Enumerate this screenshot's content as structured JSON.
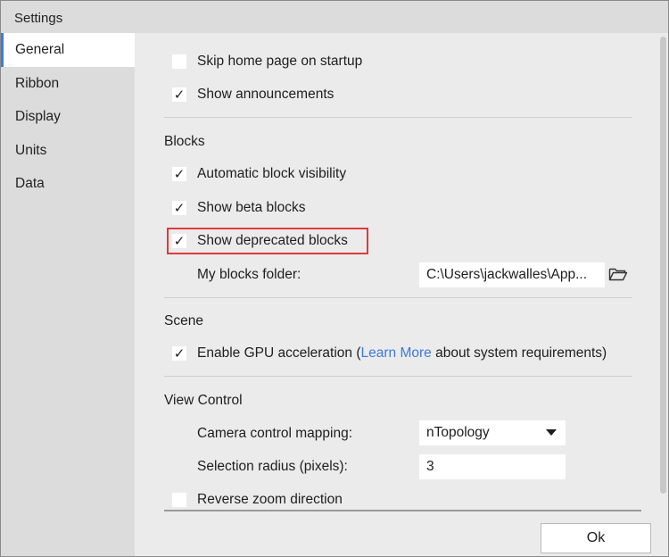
{
  "window": {
    "title": "Settings"
  },
  "sidebar": {
    "items": [
      {
        "label": "General",
        "active": true
      },
      {
        "label": "Ribbon",
        "active": false
      },
      {
        "label": "Display",
        "active": false
      },
      {
        "label": "Units",
        "active": false
      },
      {
        "label": "Data",
        "active": false
      }
    ]
  },
  "general": {
    "skip_home": {
      "label": "Skip home page on startup",
      "checked": false
    },
    "announcements": {
      "label": "Show announcements",
      "checked": true
    }
  },
  "blocks": {
    "title": "Blocks",
    "auto_visibility": {
      "label": "Automatic block visibility",
      "checked": true
    },
    "beta": {
      "label": "Show beta blocks",
      "checked": true
    },
    "deprecated": {
      "label": "Show deprecated blocks",
      "checked": true,
      "highlight_color": "#e0393c"
    },
    "folder": {
      "label": "My blocks folder:",
      "value": "C:\\Users\\jackwalles\\App...",
      "icon": "folder-open-icon"
    }
  },
  "scene": {
    "title": "Scene",
    "gpu": {
      "checked": true,
      "label_prefix": "Enable GPU acceleration (",
      "link_text": "Learn More",
      "label_suffix": " about system requirements)"
    }
  },
  "view_control": {
    "title": "View Control",
    "camera": {
      "label": "Camera control mapping:",
      "selected": "nTopology"
    },
    "selection_radius": {
      "label": "Selection radius (pixels):",
      "value": "3"
    },
    "reverse_zoom": {
      "label": "Reverse zoom direction",
      "checked": false
    }
  },
  "footer": {
    "ok_label": "Ok"
  },
  "colors": {
    "accent": "#3d79e0",
    "link": "#3d79e0",
    "highlight": "#e0393c"
  },
  "check_glyph": "✓"
}
